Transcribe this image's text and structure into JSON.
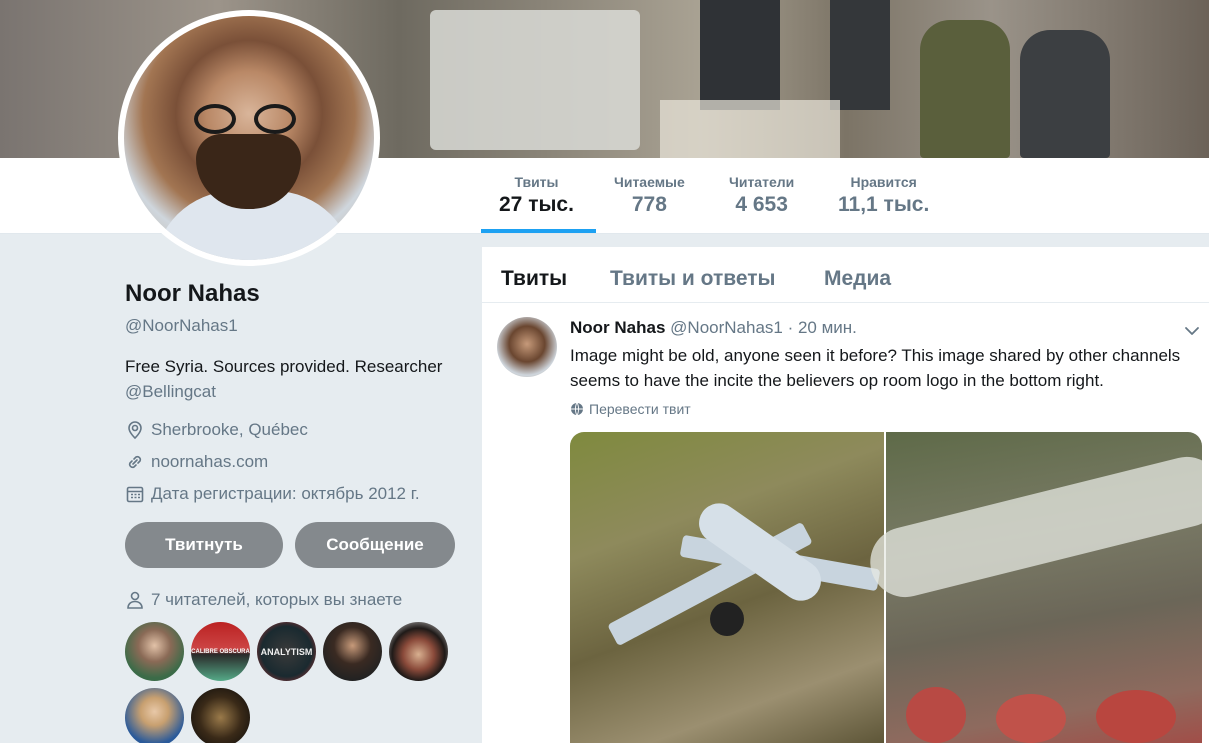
{
  "stats": [
    {
      "label": "Твиты",
      "value": "27 тыс."
    },
    {
      "label": "Читаемые",
      "value": "778"
    },
    {
      "label": "Читатели",
      "value": "4 653"
    },
    {
      "label": "Нравится",
      "value": "11,1 тыс."
    }
  ],
  "profile": {
    "name": "Noor Nahas",
    "handle": "@NoorNahas1",
    "bio": "Free Syria. Sources provided. Researcher",
    "bio_mention": "@Bellingcat",
    "location": "Sherbrooke, Québec",
    "website": "noornahas.com",
    "joined": "Дата регистрации: октябрь 2012 г.",
    "tweet_button": "Твитнуть",
    "message_button": "Сообщение",
    "followers_you_know": "7 читателей, которых вы знаете",
    "follower_avatar_texts": [
      "CALIBRE OBSCURA",
      "ANALYTISM"
    ]
  },
  "tabs": [
    "Твиты",
    "Твиты и ответы",
    "Медиа"
  ],
  "tweet": {
    "author_name": "Noor Nahas",
    "author_handle": "@NoorNahas1",
    "time": "· 20 мин.",
    "text": "Image might be old, anyone seen it before? This image shared by other channels seems to have the incite the believers op room logo in the bottom right.",
    "translate_label": "Перевести твит"
  },
  "colors": {
    "accent": "#1da1f2",
    "muted_text": "#657786",
    "page_bg": "#e6ecf0",
    "profile_button": "#84898d"
  },
  "icons": {
    "location": "location-pin-icon",
    "website": "link-icon",
    "joined": "calendar-icon",
    "followers": "person-icon",
    "translate": "globe-icon",
    "caret": "chevron-down-icon"
  }
}
